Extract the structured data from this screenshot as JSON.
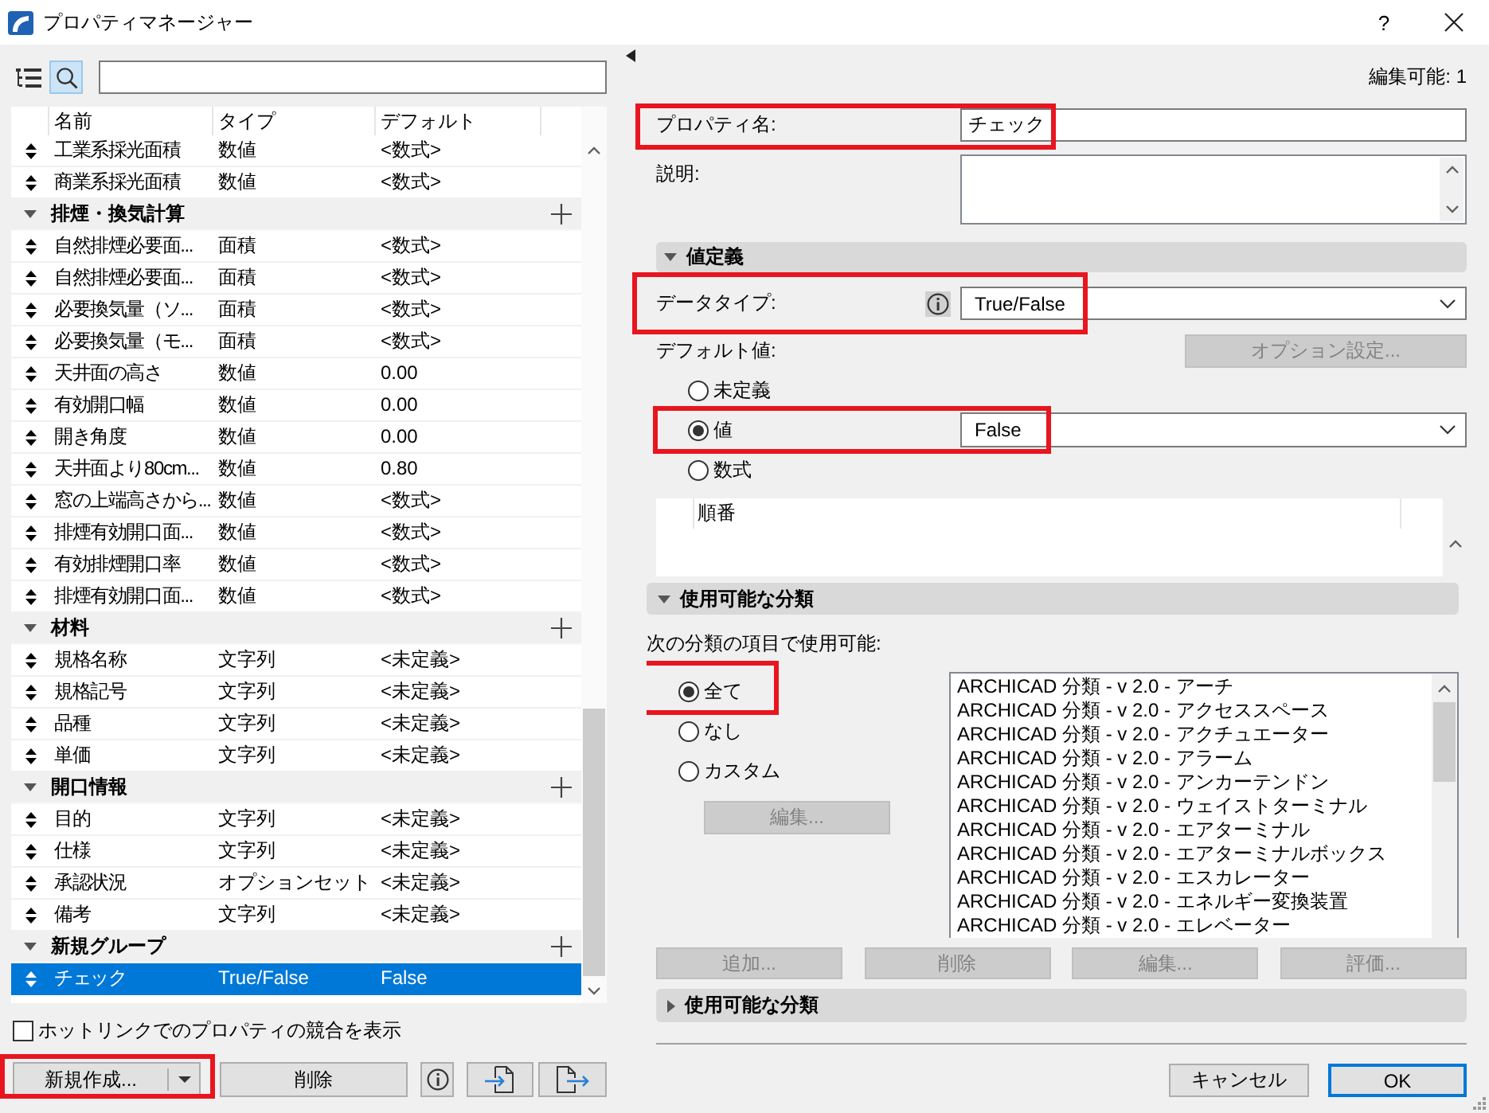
{
  "window": {
    "title": "プロパティマネージャー",
    "help": "?"
  },
  "left_panel": {
    "view_buttons": [
      {
        "kind": "tree",
        "selected": false
      },
      {
        "kind": "search",
        "selected": true
      }
    ],
    "table": {
      "columns": [
        "名前",
        "タイプ",
        "デフォルト"
      ],
      "rows": [
        {
          "kind": "property",
          "name": "工業系採光面積",
          "type": "数値",
          "default": "<数式>",
          "selected": false
        },
        {
          "kind": "property",
          "name": "商業系採光面積",
          "type": "数値",
          "default": "<数式>",
          "selected": false
        },
        {
          "kind": "group",
          "name": "排煙・換気計算",
          "expanded": true,
          "children": [
            {
              "kind": "property",
              "name": "自然排煙必要面...",
              "type": "面積",
              "default": "<数式>",
              "selected": false
            },
            {
              "kind": "property",
              "name": "自然排煙必要面...",
              "type": "面積",
              "default": "<数式>",
              "selected": false
            },
            {
              "kind": "property",
              "name": "必要換気量（ソ...",
              "type": "面積",
              "default": "<数式>",
              "selected": false
            },
            {
              "kind": "property",
              "name": "必要換気量（モ...",
              "type": "面積",
              "default": "<数式>",
              "selected": false
            },
            {
              "kind": "property",
              "name": "天井面の高さ",
              "type": "数値",
              "default": "0.00",
              "selected": false
            },
            {
              "kind": "property",
              "name": "有効開口幅",
              "type": "数値",
              "default": "0.00",
              "selected": false
            },
            {
              "kind": "property",
              "name": "開き角度",
              "type": "数値",
              "default": "0.00",
              "selected": false
            },
            {
              "kind": "property",
              "name": "天井面より80cm...",
              "type": "数値",
              "default": "0.80",
              "selected": false
            },
            {
              "kind": "property",
              "name": "窓の上端高さから...",
              "type": "数値",
              "default": "<数式>",
              "selected": false
            },
            {
              "kind": "property",
              "name": "排煙有効開口面...",
              "type": "数値",
              "default": "<数式>",
              "selected": false
            },
            {
              "kind": "property",
              "name": "有効排煙開口率",
              "type": "数値",
              "default": "<数式>",
              "selected": false
            },
            {
              "kind": "property",
              "name": "排煙有効開口面...",
              "type": "数値",
              "default": "<数式>",
              "selected": false
            }
          ]
        },
        {
          "kind": "group",
          "name": "材料",
          "expanded": true,
          "children": [
            {
              "kind": "property",
              "name": "規格名称",
              "type": "文字列",
              "default": "<未定義>",
              "selected": false
            },
            {
              "kind": "property",
              "name": "規格記号",
              "type": "文字列",
              "default": "<未定義>",
              "selected": false
            },
            {
              "kind": "property",
              "name": "品種",
              "type": "文字列",
              "default": "<未定義>",
              "selected": false
            },
            {
              "kind": "property",
              "name": "単価",
              "type": "文字列",
              "default": "<未定義>",
              "selected": false
            }
          ]
        },
        {
          "kind": "group",
          "name": "開口情報",
          "expanded": true,
          "children": [
            {
              "kind": "property",
              "name": "目的",
              "type": "文字列",
              "default": "<未定義>",
              "selected": false
            },
            {
              "kind": "property",
              "name": "仕様",
              "type": "文字列",
              "default": "<未定義>",
              "selected": false
            },
            {
              "kind": "property",
              "name": "承認状況",
              "type": "オプションセット",
              "default": "<未定義>",
              "selected": false
            },
            {
              "kind": "property",
              "name": "備考",
              "type": "文字列",
              "default": "<未定義>",
              "selected": false
            }
          ]
        },
        {
          "kind": "group",
          "name": "新規グループ",
          "expanded": true,
          "children": [
            {
              "kind": "property",
              "name": "チェック",
              "type": "True/False",
              "default": "False",
              "selected": true
            }
          ]
        }
      ]
    },
    "show_conflicts": {
      "label": "ホットリンクでのプロパティの競合を表示",
      "checked": false
    },
    "new_button": {
      "label": "新規作成...",
      "highlighted": true
    },
    "delete_button": {
      "label": "削除"
    }
  },
  "right_panel": {
    "editable_count": "編集可能: 1",
    "property_name": {
      "label": "プロパティ名:",
      "value": "チェック",
      "highlighted": true
    },
    "description": {
      "label": "説明:"
    },
    "value_definition": {
      "title": "値定義",
      "expanded": true,
      "data_type": {
        "label": "データタイプ:",
        "value": "True/False",
        "highlighted": true
      },
      "default_value": {
        "label": "デフォルト値:",
        "options_button": {
          "label": "オプション設定...",
          "disabled": true
        },
        "options": [
          {
            "label": "未定義",
            "selected": false,
            "highlighted": false
          },
          {
            "label": "値",
            "selected": true,
            "highlighted": true,
            "value": "False"
          },
          {
            "label": "数式",
            "selected": false,
            "highlighted": false
          }
        ]
      },
      "formula_table": {
        "columns": [
          "順番"
        ]
      }
    },
    "classifications": {
      "title": "使用可能な分類",
      "expanded": true,
      "prompt": "次の分類の項目で使用可能:",
      "options": [
        {
          "label": "全て",
          "selected": true,
          "highlighted": true
        },
        {
          "label": "なし",
          "selected": false,
          "highlighted": false
        },
        {
          "label": "カスタム",
          "selected": false,
          "highlighted": false
        }
      ],
      "edit_button": {
        "label": "編集...",
        "disabled": true
      },
      "items": [
        "ARCHICAD 分類 - v 2.0 - アーチ",
        "ARCHICAD 分類 - v 2.0 - アクセススペース",
        "ARCHICAD 分類 - v 2.0 - アクチュエーター",
        "ARCHICAD 分類 - v 2.0 - アラーム",
        "ARCHICAD 分類 - v 2.0 - アンカーテンドン",
        "ARCHICAD 分類 - v 2.0 - ウェイストターミナル",
        "ARCHICAD 分類 - v 2.0 - エアターミナル",
        "ARCHICAD 分類 - v 2.0 - エアターミナルボックス",
        "ARCHICAD 分類 - v 2.0 - エスカレーター",
        "ARCHICAD 分類 - v 2.0 - エネルギー変換装置",
        "ARCHICAD 分類 - v 2.0 - エレベーター"
      ]
    },
    "action_buttons": [
      {
        "label": "追加...",
        "disabled": true
      },
      {
        "label": "削除",
        "disabled": true
      },
      {
        "label": "編集...",
        "disabled": true
      },
      {
        "label": "評価...",
        "disabled": true
      }
    ],
    "second_section": {
      "title": "使用可能な分類",
      "expanded": false
    },
    "footer_buttons": [
      {
        "label": "キャンセル",
        "default": false
      },
      {
        "label": "OK",
        "default": true
      }
    ]
  }
}
